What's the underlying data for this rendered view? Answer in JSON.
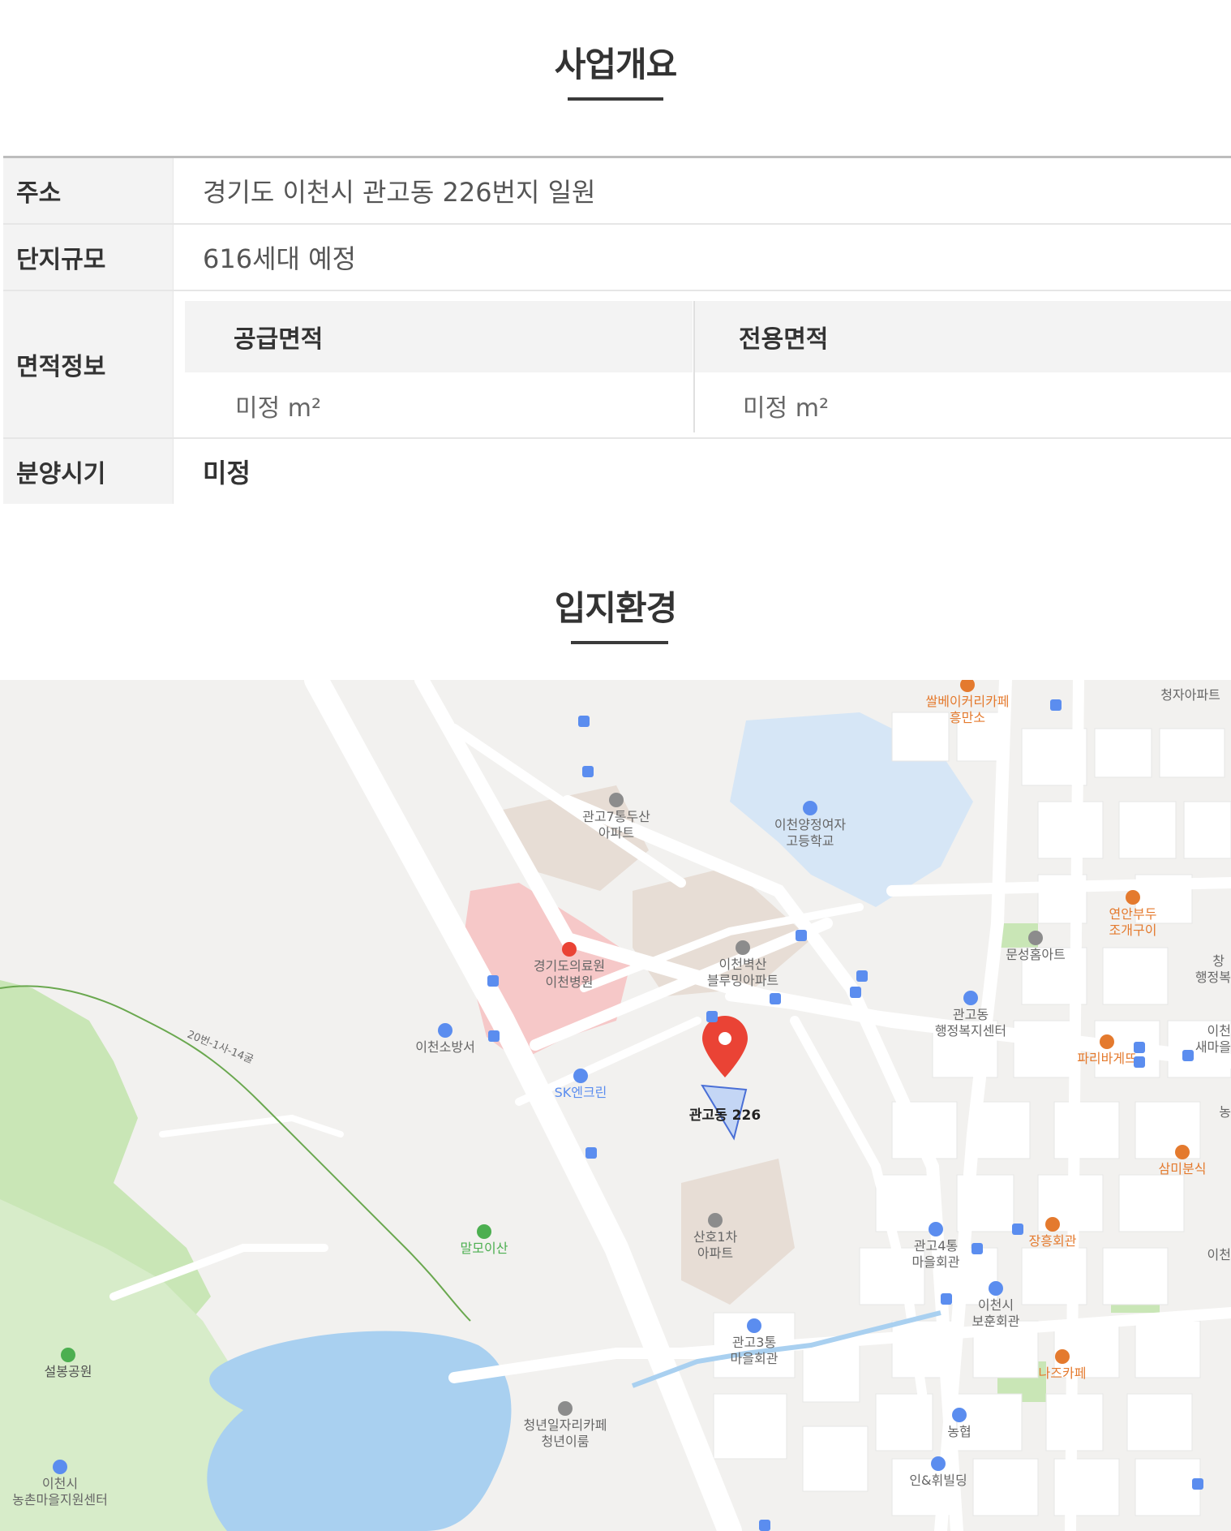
{
  "overview": {
    "title": "사업개요",
    "rows": [
      {
        "label": "주소",
        "value": "경기도 이천시 관고동 226번지 일원"
      },
      {
        "label": "단지규모",
        "value": "616세대 예정"
      },
      {
        "label": "면적정보"
      },
      {
        "label": "분양시기",
        "value": "미정"
      }
    ],
    "area": {
      "supply_label": "공급면적",
      "exclusive_label": "전용면적",
      "supply_value": "미정 m²",
      "exclusive_value": "미정 m²"
    }
  },
  "location": {
    "title": "입지환경",
    "marker_label": "관고동 226",
    "pois": {
      "ssal_bakery": "쌀베이커리카페",
      "heungmanso": "흥만소",
      "cheongja_apt": "청자아파트",
      "gwango7_line1": "관고7통두산",
      "gwango7_line2": "아파트",
      "yangjeong_line1": "이천양정여자",
      "yangjeong_line2": "고등학교",
      "yeonan_line1": "연안부두",
      "yeonan_line2": "조개구이",
      "munsung": "문성홈아트",
      "hospital_line1": "경기도의료원",
      "hospital_line2": "이천병원",
      "byeoksan_line1": "이천벽산",
      "byeoksan_line2": "블루밍아파트",
      "gwangodong_line1": "관고동",
      "gwangodong_line2": "행정복지센터",
      "fire_station": "이천소방서",
      "paris": "파리바게뜨",
      "sk": "SK엔크린",
      "sammi": "삼미분식",
      "malmoi": "말모이산",
      "sanho_line1": "산호1차",
      "sanho_line2": "아파트",
      "gwango4_line1": "관고4통",
      "gwango4_line2": "마을회관",
      "janghung": "장흥회관",
      "bohun_line1": "이천시",
      "bohun_line2": "보훈회관",
      "gwango3_line1": "관고3통",
      "gwango3_line2": "마을회관",
      "nazz": "나즈카페",
      "seolbong": "설봉공원",
      "youth_line1": "청년일자리카페",
      "youth_line2": "청년이룸",
      "nonghyup": "농협",
      "in_building": "인&휘빌딩",
      "nongchon_line1": "이천시",
      "nongchon_line2": "농촌마을지원센터",
      "road_label": "20번-1사-14굴",
      "edge_chang": "창",
      "edge_haengjeong": "행정복",
      "edge_icheon": "이천",
      "edge_saemaeul": "새마을",
      "edge_nong": "농",
      "edge_icheon2": "이천"
    },
    "colors": {
      "water": "#a9d0f0",
      "park": "#c9e6b6",
      "hospital_zone": "#f6c8c8",
      "school_zone": "#d6e6f6",
      "marker": "#ea4335",
      "poi_text": "#666666",
      "food_text": "#e47a2e"
    }
  }
}
